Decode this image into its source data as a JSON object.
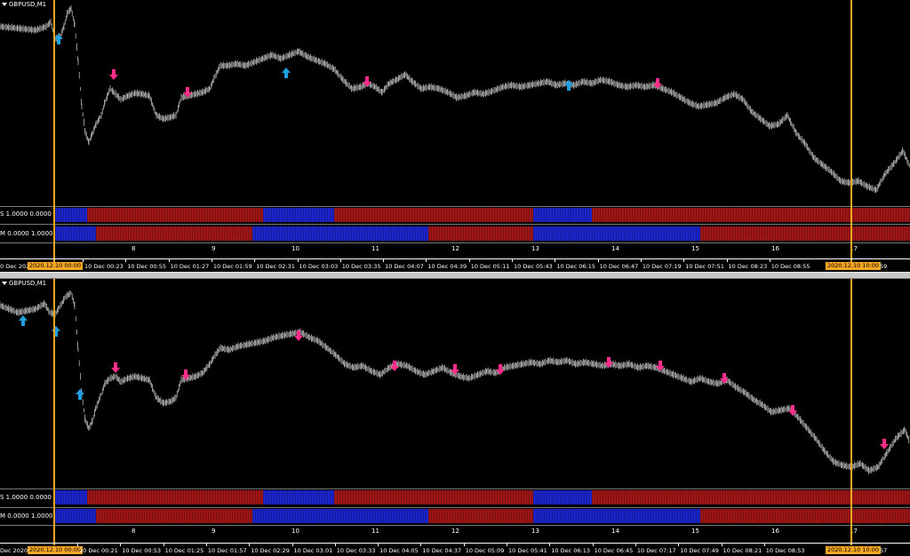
{
  "windows": [
    {
      "id": "w1",
      "title": "GBPUSD,M1",
      "sub1_label": "S 1.0000 0.0000",
      "sub2_label": "M 0.0000 1.0000",
      "time_axis": {
        "left_fragment": "0 Dec 202",
        "highlight_left": "2020.12.10 00:00",
        "labels": [
          "10 Dec 00:23",
          "10 Dec 00:55",
          "10 Dec 01:27",
          "10 Dec 01:59",
          "10 Dec 02:31",
          "10 Dec 03:03",
          "10 Dec 03:35",
          "10 Dec 04:07",
          "10 Dec 04:39",
          "10 Dec 05:11",
          "10 Dec 05:43",
          "10 Dec 06:15",
          "10 Dec 06:47",
          "10 Dec 07:19",
          "10 Dec 07:51",
          "10 Dec 08:23",
          "10 Dec 08:55"
        ],
        "highlight_right": "2020.12.10 10:00",
        "right_fragment": "59"
      },
      "period_labels": [
        "8",
        "9",
        "10",
        "11",
        "12",
        "13",
        "14",
        "15",
        "16",
        "17"
      ]
    },
    {
      "id": "w2",
      "title": "GBPUSD,M1",
      "sub1_label": "S 1.0000 0.0000",
      "sub2_label": "M 0.0000 1.0000",
      "time_axis": {
        "left_fragment": "Dec 2020",
        "highlight_left": "2020.12.10 00:00",
        "labels": [
          "10 Dec 00:21",
          "10 Dec 00:53",
          "10 Dec 01:25",
          "10 Dec 01:57",
          "10 Dec 02:29",
          "10 Dec 03:01",
          "10 Dec 03:33",
          "10 Dec 04:05",
          "10 Dec 04:37",
          "10 Dec 05:09",
          "10 Dec 05:41",
          "10 Dec 06:13",
          "10 Dec 06:45",
          "10 Dec 07:17",
          "10 Dec 07:49",
          "10 Dec 08:21",
          "10 Dec 08:53"
        ],
        "highlight_right": "2020.12.10 10:00",
        "right_fragment": "57"
      },
      "period_labels": [
        "8",
        "9",
        "10",
        "11",
        "12",
        "13",
        "14",
        "15",
        "16",
        "17"
      ]
    }
  ],
  "colors": {
    "background": "#000000",
    "price_line": "#e8e8e8",
    "arrow_up": "#1e9fe0",
    "arrow_down": "#ff2d8a",
    "state_red": "#9e1515",
    "state_blue": "#1a24c8",
    "vertical_line": "#f5a623",
    "highlight_tag": "#f5a623"
  },
  "icons": {
    "up_signal": "arrow-up-icon",
    "down_signal": "arrow-down-icon",
    "menu": "triangle-down-icon"
  }
}
